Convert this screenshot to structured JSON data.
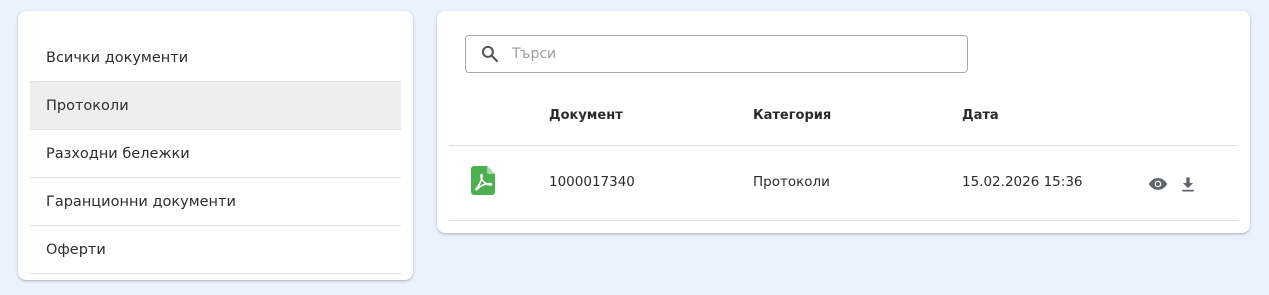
{
  "sidebar": {
    "items": [
      {
        "label": "Всички документи"
      },
      {
        "label": "Протоколи",
        "active": true
      },
      {
        "label": "Разходни бележки"
      },
      {
        "label": "Гаранционни документи"
      },
      {
        "label": "Оферти"
      }
    ]
  },
  "search": {
    "placeholder": "Търси",
    "value": ""
  },
  "table": {
    "headers": {
      "document": "Документ",
      "category": "Категория",
      "date": "Дата"
    },
    "rows": [
      {
        "file_icon": "pdf-icon",
        "document": "1000017340",
        "category": "Протоколи",
        "date": "15.02.2026 15:36",
        "actions": [
          "eye-icon",
          "download-icon"
        ]
      }
    ]
  },
  "colors": {
    "background": "#eaf3fd",
    "active_item": "#eeeeee",
    "pdf_icon": "#4caf50",
    "action_icon": "#5f6368"
  }
}
